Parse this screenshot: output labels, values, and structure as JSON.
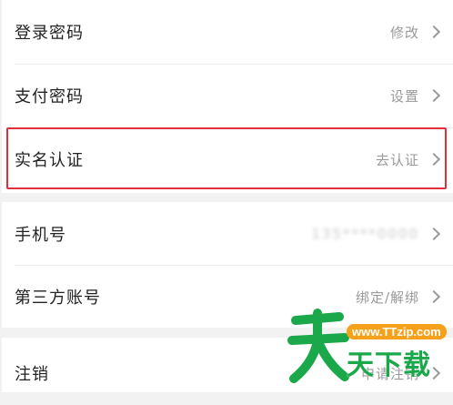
{
  "settings": {
    "rows": [
      {
        "label": "登录密码",
        "action": "修改"
      },
      {
        "label": "支付密码",
        "action": "设置"
      },
      {
        "label": "实名认证",
        "action": "去认证"
      },
      {
        "label": "手机号",
        "action": "135****0000"
      },
      {
        "label": "第三方账号",
        "action": "绑定/解绑"
      },
      {
        "label": "注销",
        "action": "申请注销"
      }
    ]
  },
  "watermark": {
    "url": "www.TTzip.com",
    "text": "天下载",
    "logo_char": "天"
  },
  "colors": {
    "highlight": "#e0303a",
    "watermark_green": "#1aa84a",
    "watermark_orange": "#f7a11a"
  },
  "icons": {
    "chevron": "chevron-right-icon"
  }
}
